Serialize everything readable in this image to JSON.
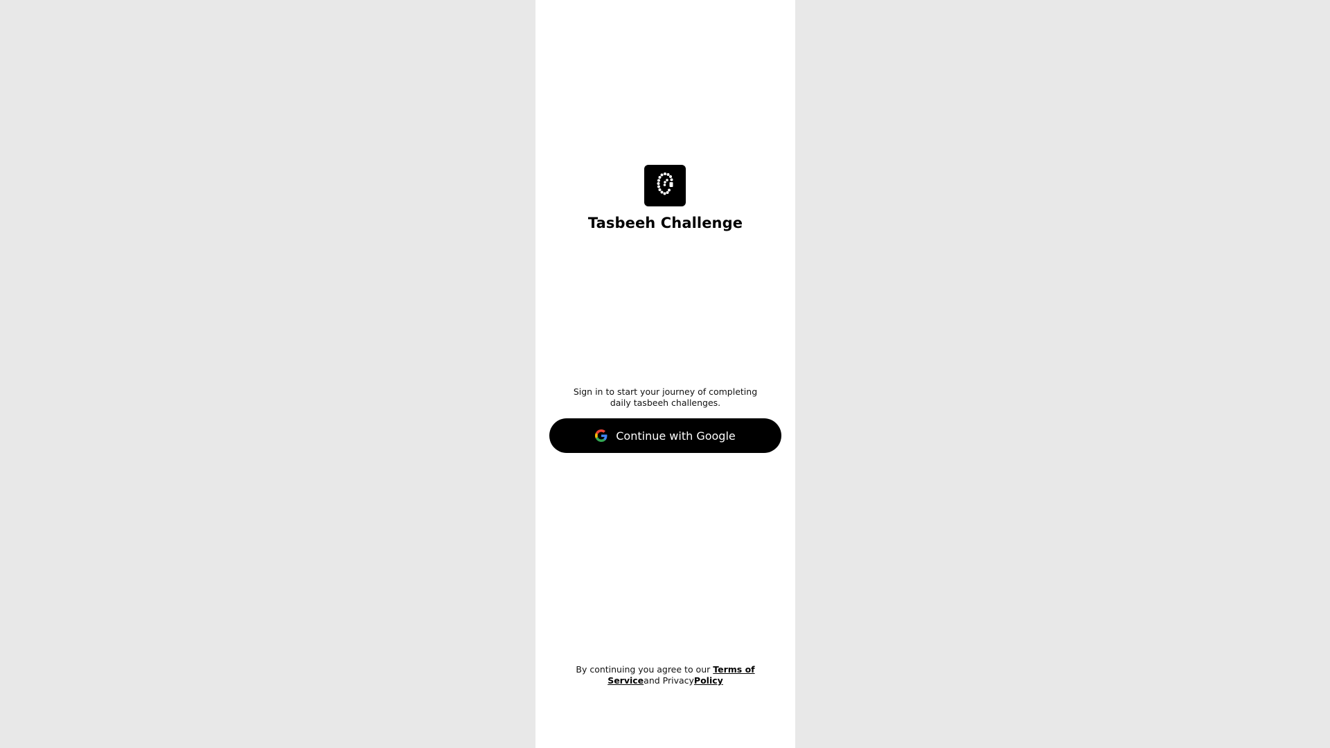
{
  "app": {
    "title": "Tasbeeh Challenge",
    "logo_icon": "tasbeeh-beads-icon"
  },
  "auth": {
    "tagline": "Sign in to start your journey of completing daily tasbeeh challenges.",
    "google_button_label": "Continue with Google",
    "google_icon": "google-icon"
  },
  "legal": {
    "prefix": "By continuing you agree to our ",
    "terms_link": "Terms of Service",
    "middle": "and Privacy",
    "policy_link": "Policy"
  },
  "colors": {
    "background": "#e8e8e8",
    "panel": "#ffffff",
    "primary": "#000000",
    "on_primary": "#ffffff"
  }
}
